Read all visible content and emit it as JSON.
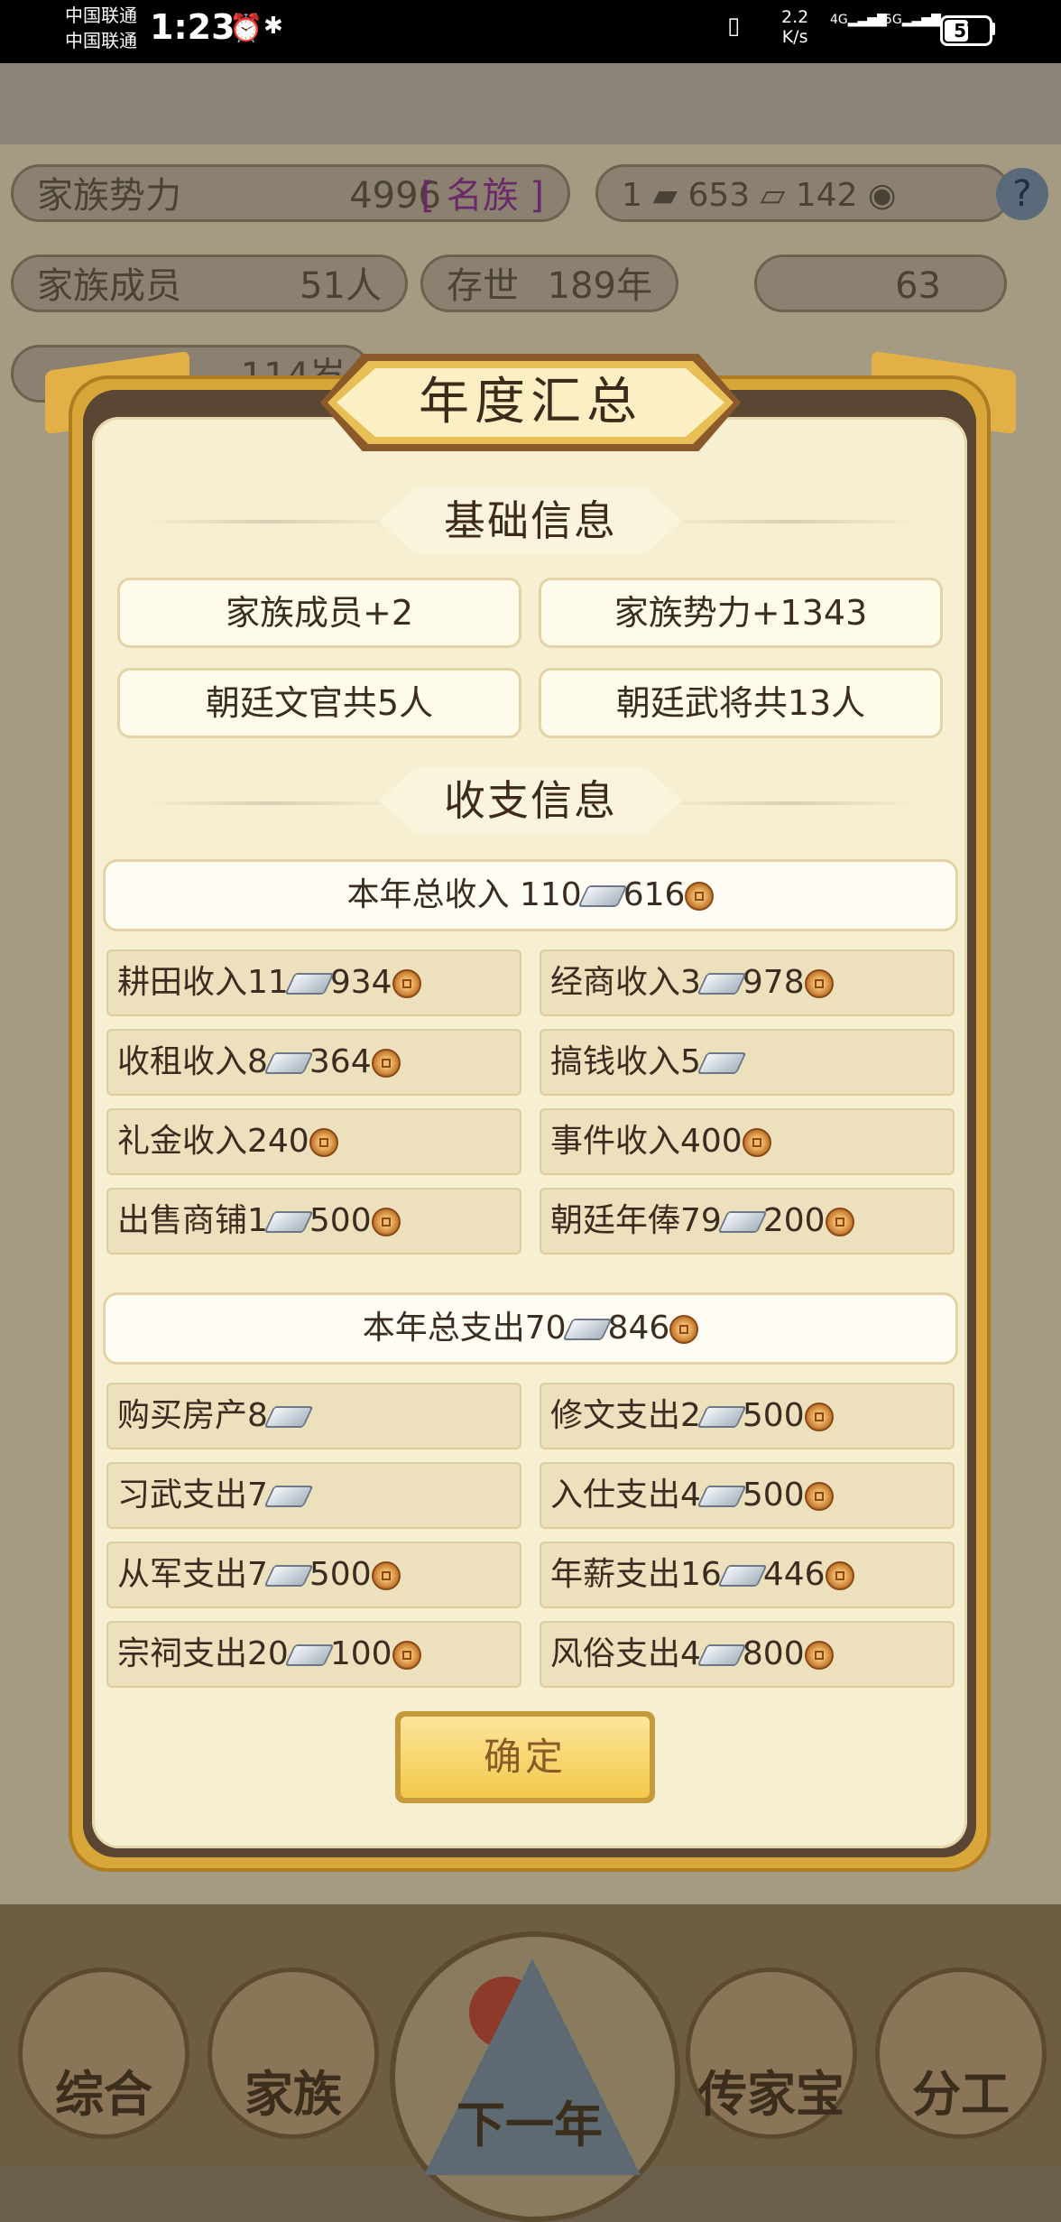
{
  "status_bar": {
    "carrier1": "中国联通",
    "carrier2": "中国联通",
    "time": "1:23",
    "net_speed_value": "2.2",
    "net_speed_unit": "K/s",
    "signal1": "4G",
    "signal2": "5G",
    "battery": "57"
  },
  "background": {
    "family_power_label": "家族势力",
    "family_power_value": "4996",
    "family_power_rank": "[ 名族 ]",
    "currency_gold": "1",
    "currency_silver": "653",
    "currency_copper": "142",
    "help": "?",
    "members_label": "家族成员",
    "members_value": "51人",
    "exist_label": "存世",
    "exist_value": "189年",
    "ingot_value": "63",
    "age_value": "114岁",
    "nav": [
      "综合",
      "家族",
      "下一年",
      "传家宝",
      "分工"
    ]
  },
  "modal": {
    "title": "年度汇总",
    "basic_section": "基础信息",
    "basic_items": [
      "家族成员+2",
      "家族势力+1343",
      "朝廷文官共5人",
      "朝廷武将共13人"
    ],
    "finance_section": "收支信息",
    "income_total": {
      "text": "本年总收入 110",
      "silver": "616"
    },
    "income_items": [
      {
        "label": "耕田收入11",
        "amount": "934",
        "coin": true
      },
      {
        "label": "经商收入3",
        "amount": "978",
        "coin": true
      },
      {
        "label": "收租收入8",
        "amount": "364",
        "coin": true
      },
      {
        "label": "搞钱收入5",
        "amount": "",
        "coin": false
      },
      {
        "label": "礼金收入240",
        "amount": "",
        "coin": true,
        "silver": false
      },
      {
        "label": "事件收入400",
        "amount": "",
        "coin": true,
        "silver": false
      },
      {
        "label": "出售商铺1",
        "amount": "500",
        "coin": true
      },
      {
        "label": "朝廷年俸79",
        "amount": "200",
        "coin": true
      }
    ],
    "expense_total": {
      "text": "本年总支出70",
      "silver": "846"
    },
    "expense_items": [
      {
        "label": "购买房产8",
        "amount": "",
        "coin": false
      },
      {
        "label": "修文支出2",
        "amount": "500",
        "coin": true
      },
      {
        "label": "习武支出7",
        "amount": "",
        "coin": false
      },
      {
        "label": "入仕支出4",
        "amount": "500",
        "coin": true
      },
      {
        "label": "从军支出7",
        "amount": "500",
        "coin": true
      },
      {
        "label": "年薪支出16",
        "amount": "446",
        "coin": true
      },
      {
        "label": "宗祠支出20",
        "amount": "100",
        "coin": true
      },
      {
        "label": "风俗支出4",
        "amount": "800",
        "coin": true
      }
    ],
    "confirm": "确定"
  },
  "colors": {
    "modal_gold": "#d9a63a",
    "panel": "#f7efd2",
    "confirm_yellow": "#f2c94b"
  }
}
